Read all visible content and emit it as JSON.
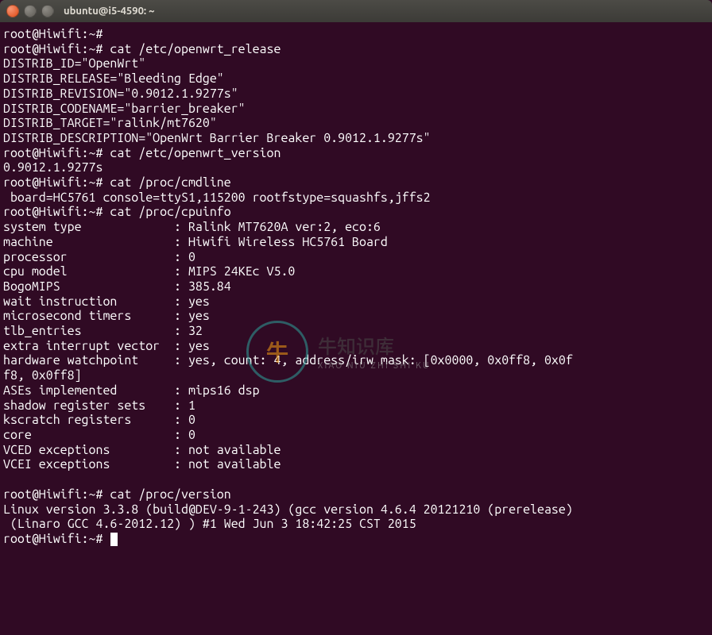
{
  "window": {
    "title": "ubuntu@i5-4590: ~"
  },
  "watermark": {
    "big": "   牛知识库",
    "small": "XIAO NIU ZHI SHI KU"
  },
  "terminal": {
    "prompt": "root@Hiwifi:~#",
    "commands": [
      "",
      "cat /etc/openwrt_release",
      "cat /etc/openwrt_version",
      "cat /proc/cmdline",
      "cat /proc/cpuinfo",
      "cat /proc/version"
    ],
    "openwrt_release": {
      "DISTRIB_ID": "OpenWrt",
      "DISTRIB_RELEASE": "Bleeding Edge",
      "DISTRIB_REVISION": "0.9012.1.9277s",
      "DISTRIB_CODENAME": "barrier_breaker",
      "DISTRIB_TARGET": "ralink/mt7620",
      "DISTRIB_DESCRIPTION": "OpenWrt Barrier Breaker 0.9012.1.9277s"
    },
    "openwrt_version": "0.9012.1.9277s",
    "cmdline": " board=HC5761 console=ttyS1,115200 rootfstype=squashfs,jffs2",
    "cpuinfo": {
      "system type": "Ralink MT7620A ver:2, eco:6",
      "machine": "Hiwifi Wireless HC5761 Board",
      "processor": "0",
      "cpu model": "MIPS 24KEc V5.0",
      "BogoMIPS": "385.84",
      "wait instruction": "yes",
      "microsecond timers": "yes",
      "tlb_entries": "32",
      "extra interrupt vector": "yes",
      "hardware watchpoint": "yes, count: 4, address/irw mask: [0x0000, 0x0ff8, 0x0ff8, 0x0ff8]",
      "ASEs implemented": "mips16 dsp",
      "shadow register sets": "1",
      "kscratch registers": "0",
      "core": "0",
      "VCED exceptions": "not available",
      "VCEI exceptions": "not available"
    },
    "version": "Linux version 3.3.8 (build@DEV-9-1-243) (gcc version 4.6.4 20121210 (prerelease) (Linaro GCC 4.6-2012.12) ) #1 Wed Jun 3 18:42:25 CST 2015",
    "text": "root@Hiwifi:~#\nroot@Hiwifi:~# cat /etc/openwrt_release\nDISTRIB_ID=\"OpenWrt\"\nDISTRIB_RELEASE=\"Bleeding Edge\"\nDISTRIB_REVISION=\"0.9012.1.9277s\"\nDISTRIB_CODENAME=\"barrier_breaker\"\nDISTRIB_TARGET=\"ralink/mt7620\"\nDISTRIB_DESCRIPTION=\"OpenWrt Barrier Breaker 0.9012.1.9277s\"\nroot@Hiwifi:~# cat /etc/openwrt_version\n0.9012.1.9277s\nroot@Hiwifi:~# cat /proc/cmdline\n board=HC5761 console=ttyS1,115200 rootfstype=squashfs,jffs2\nroot@Hiwifi:~# cat /proc/cpuinfo\nsystem type             : Ralink MT7620A ver:2, eco:6\nmachine                 : Hiwifi Wireless HC5761 Board\nprocessor               : 0\ncpu model               : MIPS 24KEc V5.0\nBogoMIPS                : 385.84\nwait instruction        : yes\nmicrosecond timers      : yes\ntlb_entries             : 32\nextra interrupt vector  : yes\nhardware watchpoint     : yes, count: 4, address/irw mask: [0x0000, 0x0ff8, 0x0f\nf8, 0x0ff8]\nASEs implemented        : mips16 dsp\nshadow register sets    : 1\nkscratch registers      : 0\ncore                    : 0\nVCED exceptions         : not available\nVCEI exceptions         : not available\n\nroot@Hiwifi:~# cat /proc/version\nLinux version 3.3.8 (build@DEV-9-1-243) (gcc version 4.6.4 20121210 (prerelease)\n (Linaro GCC 4.6-2012.12) ) #1 Wed Jun 3 18:42:25 CST 2015\nroot@Hiwifi:~# "
  }
}
